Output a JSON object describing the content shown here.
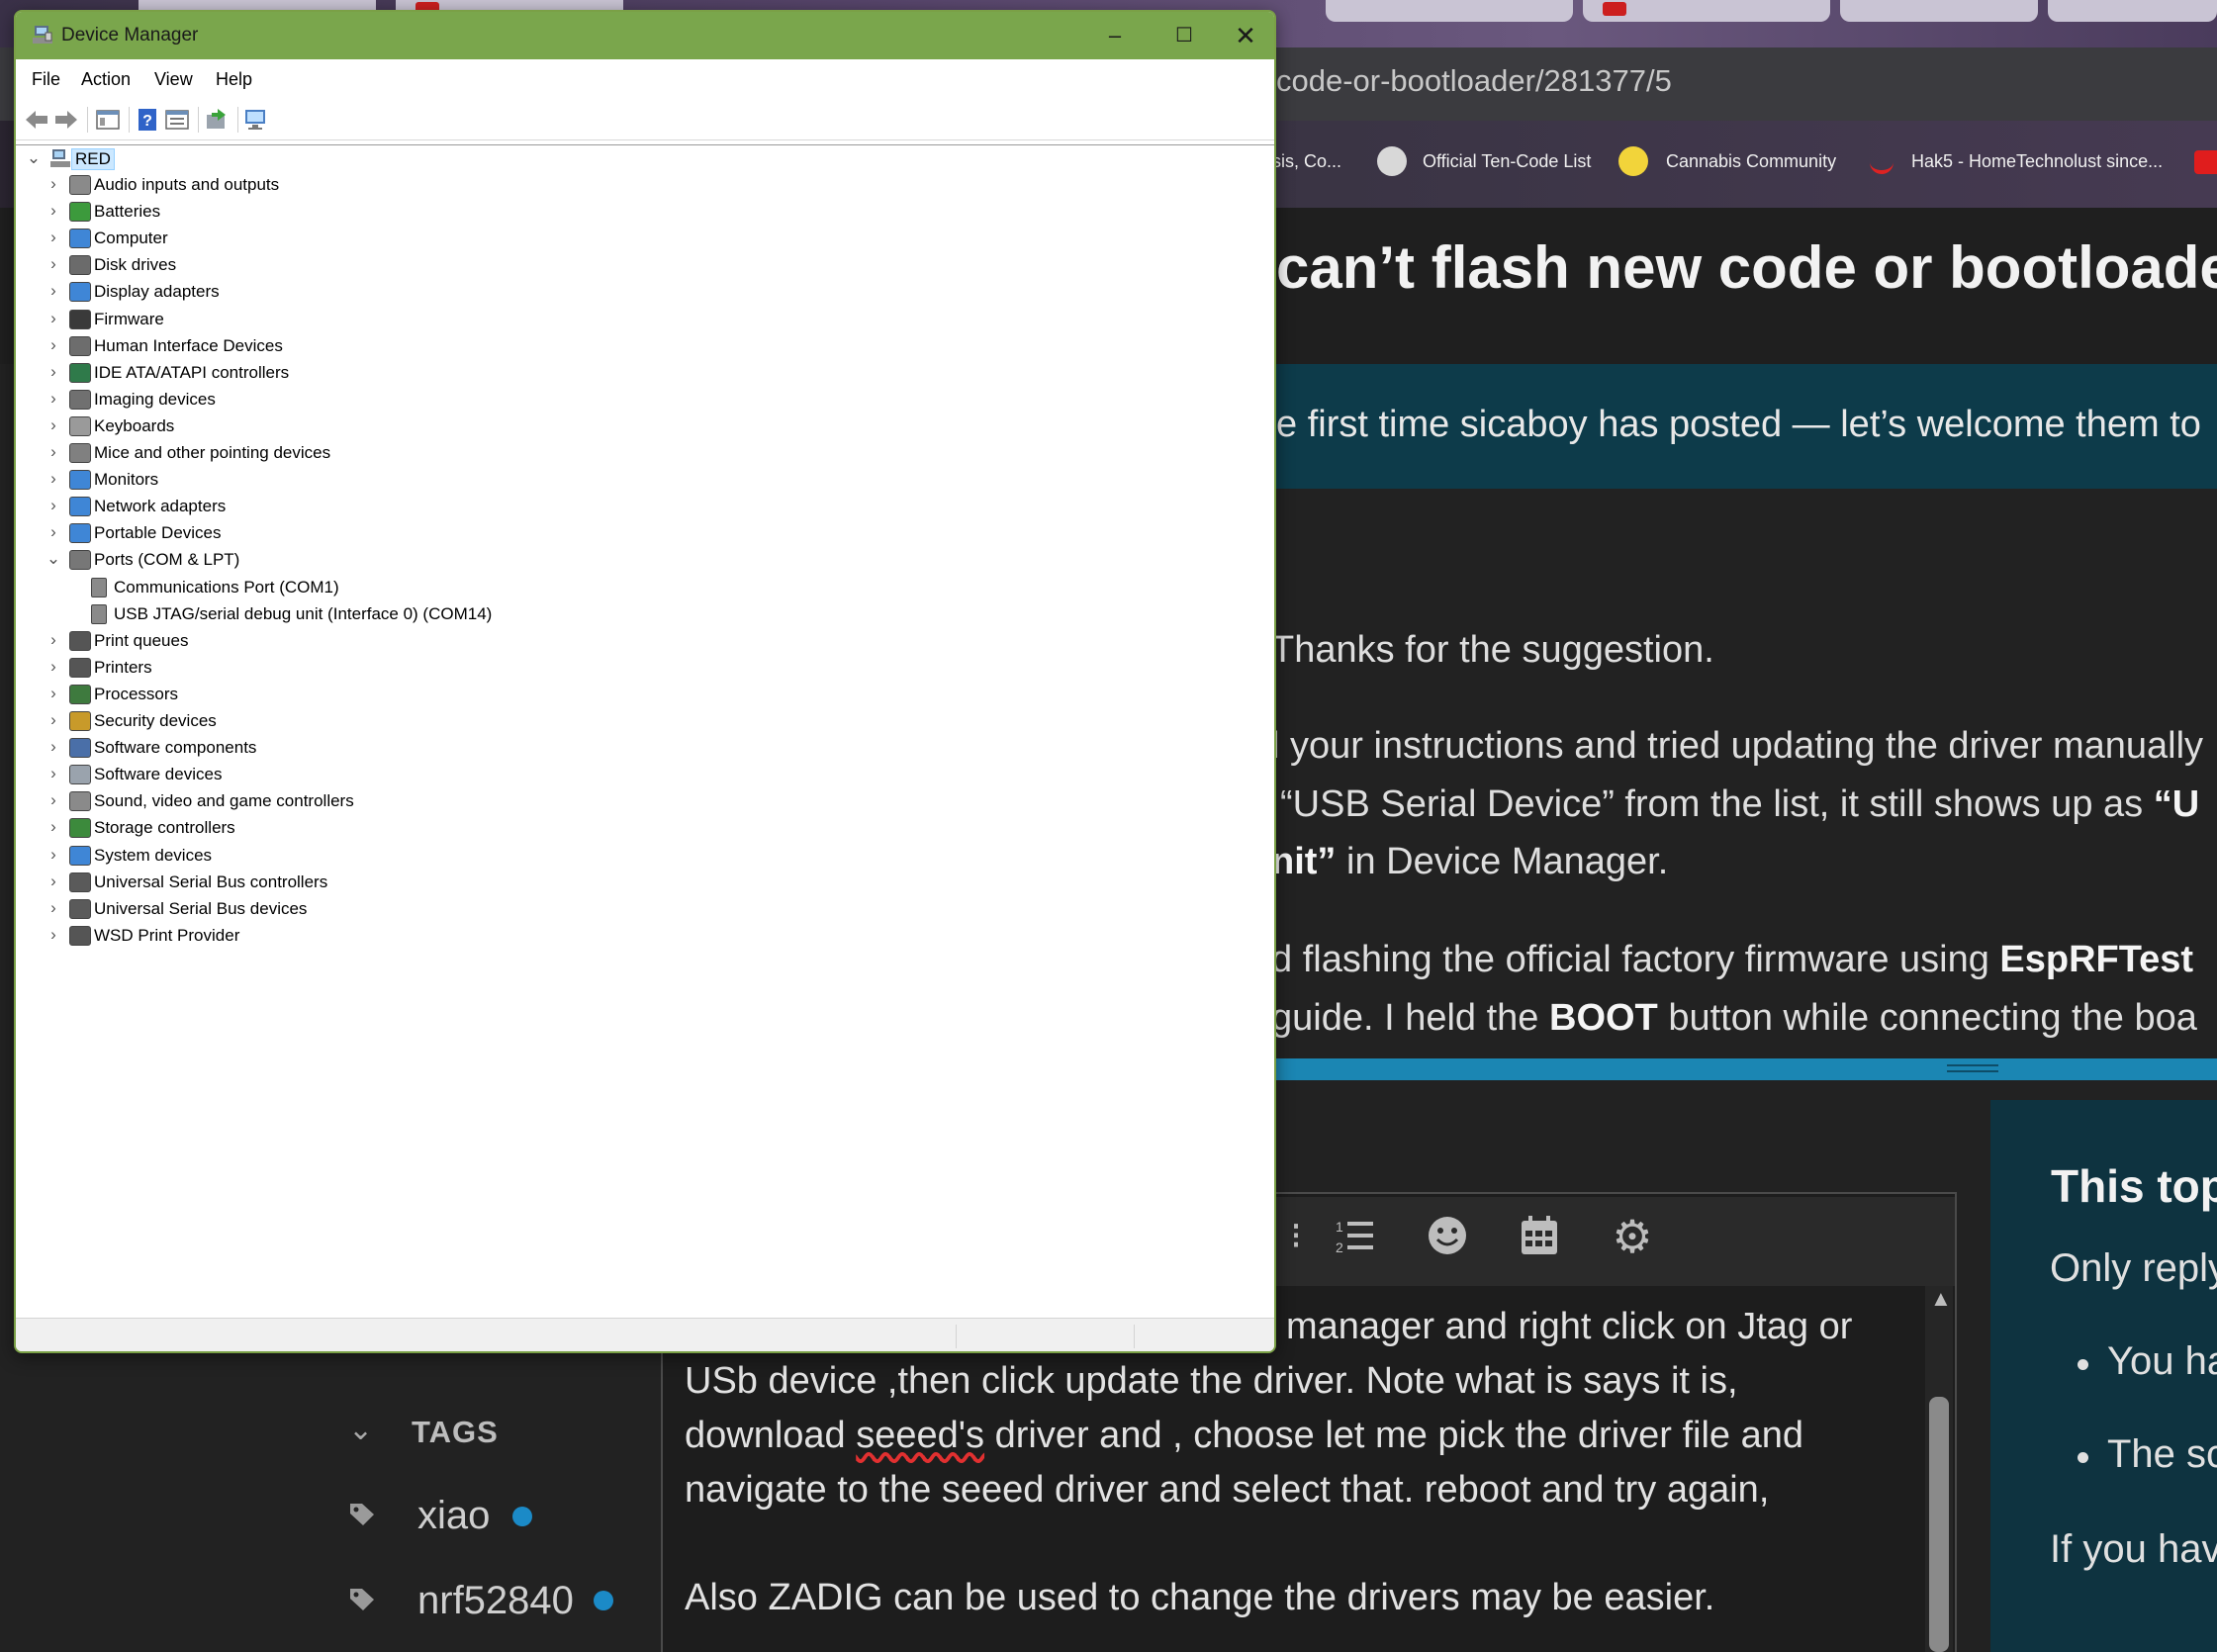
{
  "browser": {
    "url_fragment": "code-or-bootloader/281377/5",
    "bookmarks": [
      {
        "label": "sis, Co...",
        "icon": "bookmark-icon"
      },
      {
        "label": "Official Ten-Code List",
        "icon": "globe-icon"
      },
      {
        "label": "Cannabis Community",
        "icon": "chick-icon"
      },
      {
        "label": "Hak5 - HomeTechnolust since...",
        "icon": "hak5-icon"
      }
    ],
    "topic_title": "can’t flash new code or bootloade",
    "welcome_text": "e first time sicaboy has posted — let’s welcome them to",
    "post": {
      "line1": "Thanks for the suggestion.",
      "line2": "l your instructions and tried updating the driver manually",
      "line3": "“USB Serial Device” from the list, it still shows up as ",
      "line3_bold": "“U",
      "line4_bold": "nit”",
      "line4": " in Device Manager.",
      "line5": "d flashing the official factory firmware using ",
      "line5_bold": "EspRFTest",
      "line6": "guide. I held the ",
      "line6_bold": "BOOT",
      "line6_rest": " button while connecting the boa"
    },
    "composer": {
      "reply_lines": [
        "manager and right click on Jtag or",
        "USb device ,then click update the driver. Note what is says it is,",
        "download ",
        "seeed's",
        " driver and , choose let me pick the driver file and",
        "navigate to the seeed driver and select that. reboot and try again,",
        "Also ZADIG can be used to change the drivers may be easier."
      ]
    },
    "tags": {
      "heading": "TAGS",
      "items": [
        "xiao",
        "nrf52840"
      ]
    },
    "right_panel": {
      "title": "This top",
      "subtitle": "Only reply",
      "bullets": [
        "You ha",
        "The sc"
      ],
      "footer": "If you hav"
    }
  },
  "device_manager": {
    "title": "Device Manager",
    "menu": [
      "File",
      "Action",
      "View",
      "Help"
    ],
    "root": "RED",
    "categories": [
      {
        "label": "Audio inputs and outputs",
        "icon": "speaker-icon"
      },
      {
        "label": "Batteries",
        "icon": "battery-icon"
      },
      {
        "label": "Computer",
        "icon": "computer-icon"
      },
      {
        "label": "Disk drives",
        "icon": "disk-drive-icon"
      },
      {
        "label": "Display adapters",
        "icon": "display-adapter-icon"
      },
      {
        "label": "Firmware",
        "icon": "firmware-icon"
      },
      {
        "label": "Human Interface Devices",
        "icon": "hid-icon"
      },
      {
        "label": "IDE ATA/ATAPI controllers",
        "icon": "ide-controller-icon"
      },
      {
        "label": "Imaging devices",
        "icon": "camera-icon"
      },
      {
        "label": "Keyboards",
        "icon": "keyboard-icon"
      },
      {
        "label": "Mice and other pointing devices",
        "icon": "mouse-icon"
      },
      {
        "label": "Monitors",
        "icon": "monitor-icon"
      },
      {
        "label": "Network adapters",
        "icon": "network-adapter-icon"
      },
      {
        "label": "Portable Devices",
        "icon": "portable-device-icon"
      },
      {
        "label": "Ports (COM & LPT)",
        "icon": "port-icon",
        "expanded": true
      },
      {
        "label": "Print queues",
        "icon": "printer-icon"
      },
      {
        "label": "Printers",
        "icon": "printer-icon"
      },
      {
        "label": "Processors",
        "icon": "processor-icon"
      },
      {
        "label": "Security devices",
        "icon": "security-device-icon"
      },
      {
        "label": "Software components",
        "icon": "software-component-icon"
      },
      {
        "label": "Software devices",
        "icon": "software-device-icon"
      },
      {
        "label": "Sound, video and game controllers",
        "icon": "speaker-icon"
      },
      {
        "label": "Storage controllers",
        "icon": "storage-controller-icon"
      },
      {
        "label": "System devices",
        "icon": "system-device-icon"
      },
      {
        "label": "Universal Serial Bus controllers",
        "icon": "usb-icon"
      },
      {
        "label": "Universal Serial Bus devices",
        "icon": "usb-icon"
      },
      {
        "label": "WSD Print Provider",
        "icon": "printer-icon"
      }
    ],
    "port_children": [
      "Communications Port (COM1)",
      "USB JTAG/serial debug unit (Interface 0) (COM14)"
    ]
  },
  "colors": {
    "titlebar": "#7aa64c",
    "selection": "#cce8ff",
    "link_blue": "#1b86b3",
    "welcome_bg": "#0d3b4a"
  }
}
